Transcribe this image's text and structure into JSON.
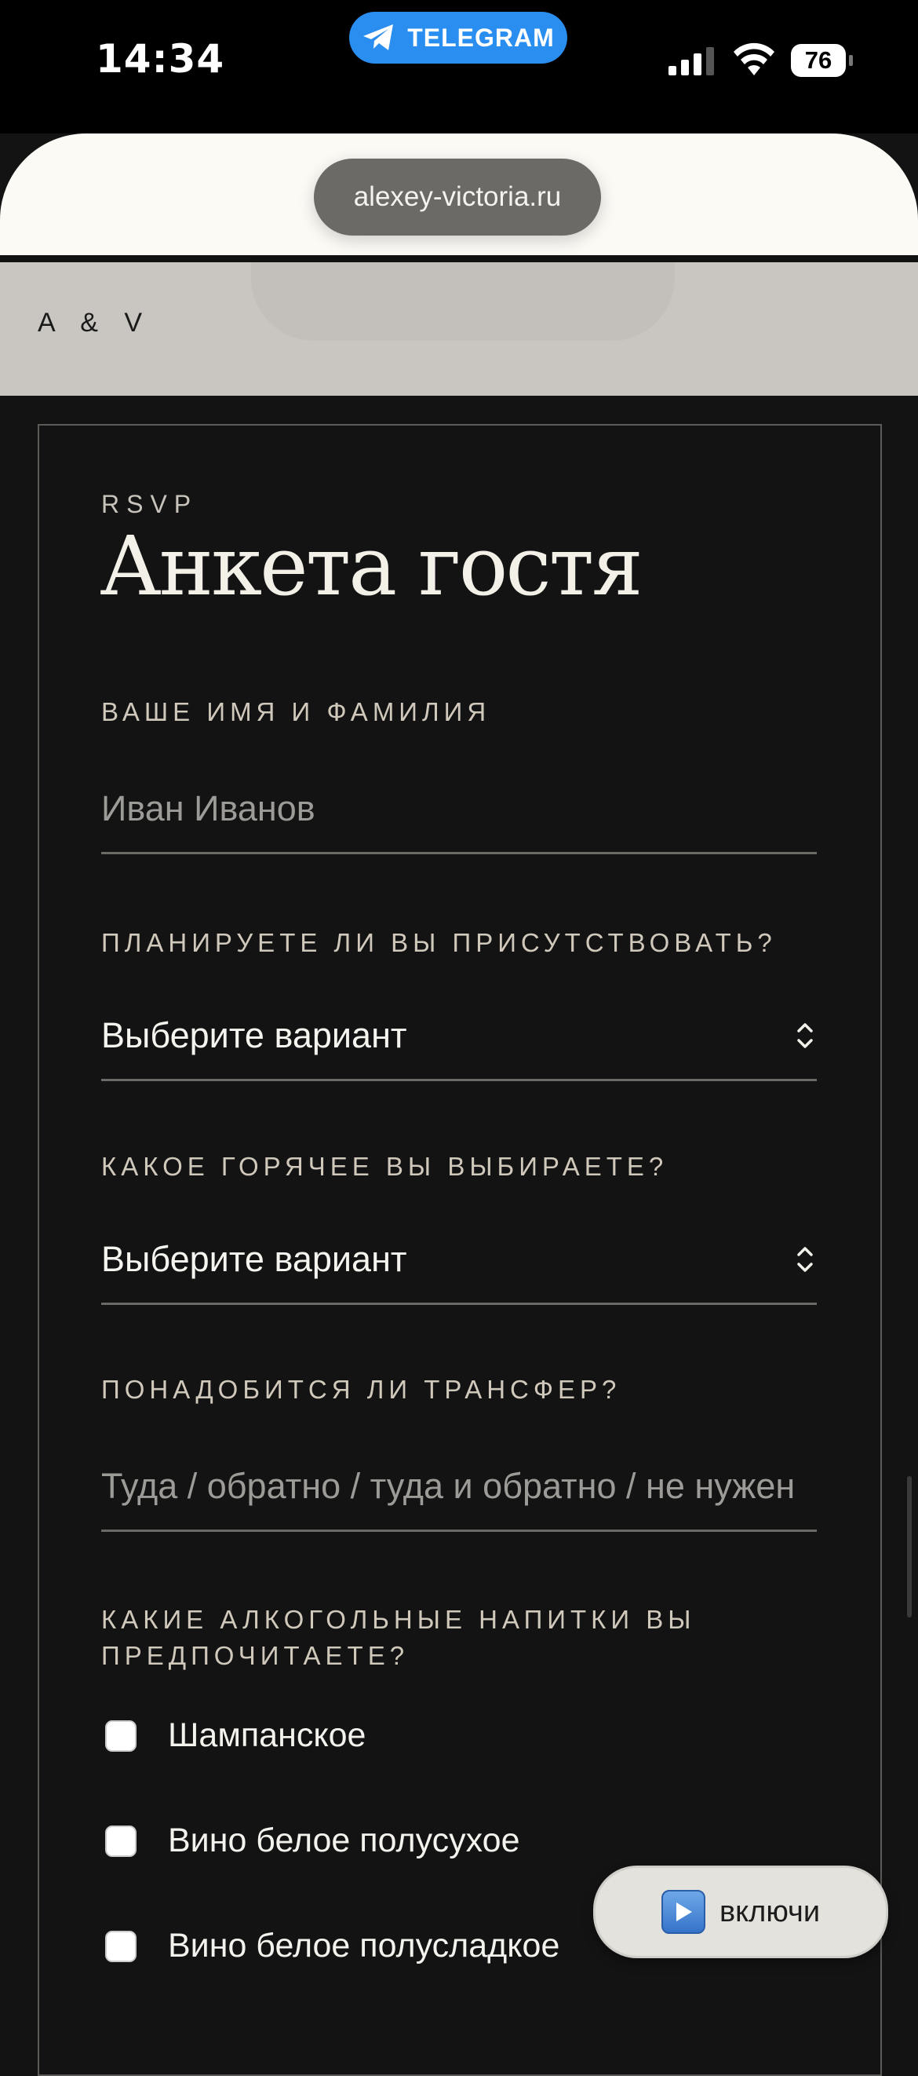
{
  "status_bar": {
    "time": "14:34",
    "telegram_label": "TELEGRAM",
    "battery": "76"
  },
  "browser": {
    "url": "alexey-victoria.ru"
  },
  "site": {
    "logo": "A & V"
  },
  "form": {
    "eyebrow": "RSVP",
    "title": "Анкета гостя",
    "name_label": "ВАШЕ ИМЯ И ФАМИЛИЯ",
    "name_placeholder": "Иван Иванов",
    "attend_label": "ПЛАНИРУЕТЕ ЛИ ВЫ ПРИСУТСТВОВАТЬ?",
    "attend_value": "Выберите вариант",
    "hot_label": "КАКОЕ ГОРЯЧЕЕ ВЫ ВЫБИРАЕТЕ?",
    "hot_value": "Выберите вариант",
    "transfer_label": "ПОНАДОБИТСЯ ЛИ ТРАНСФЕР?",
    "transfer_placeholder": "Туда / обратно / туда и обратно / не нужен",
    "drinks_label_line1": "КАКИЕ АЛКОГОЛЬНЫЕ НАПИТКИ ВЫ",
    "drinks_label_line2": "ПРЕДПОЧИТАЕТЕ?",
    "drinks": [
      "Шампанское",
      "Вино белое полусухое",
      "Вино белое полусладкое"
    ]
  },
  "music_button": {
    "label": "включи",
    "icon": "play-icon"
  }
}
